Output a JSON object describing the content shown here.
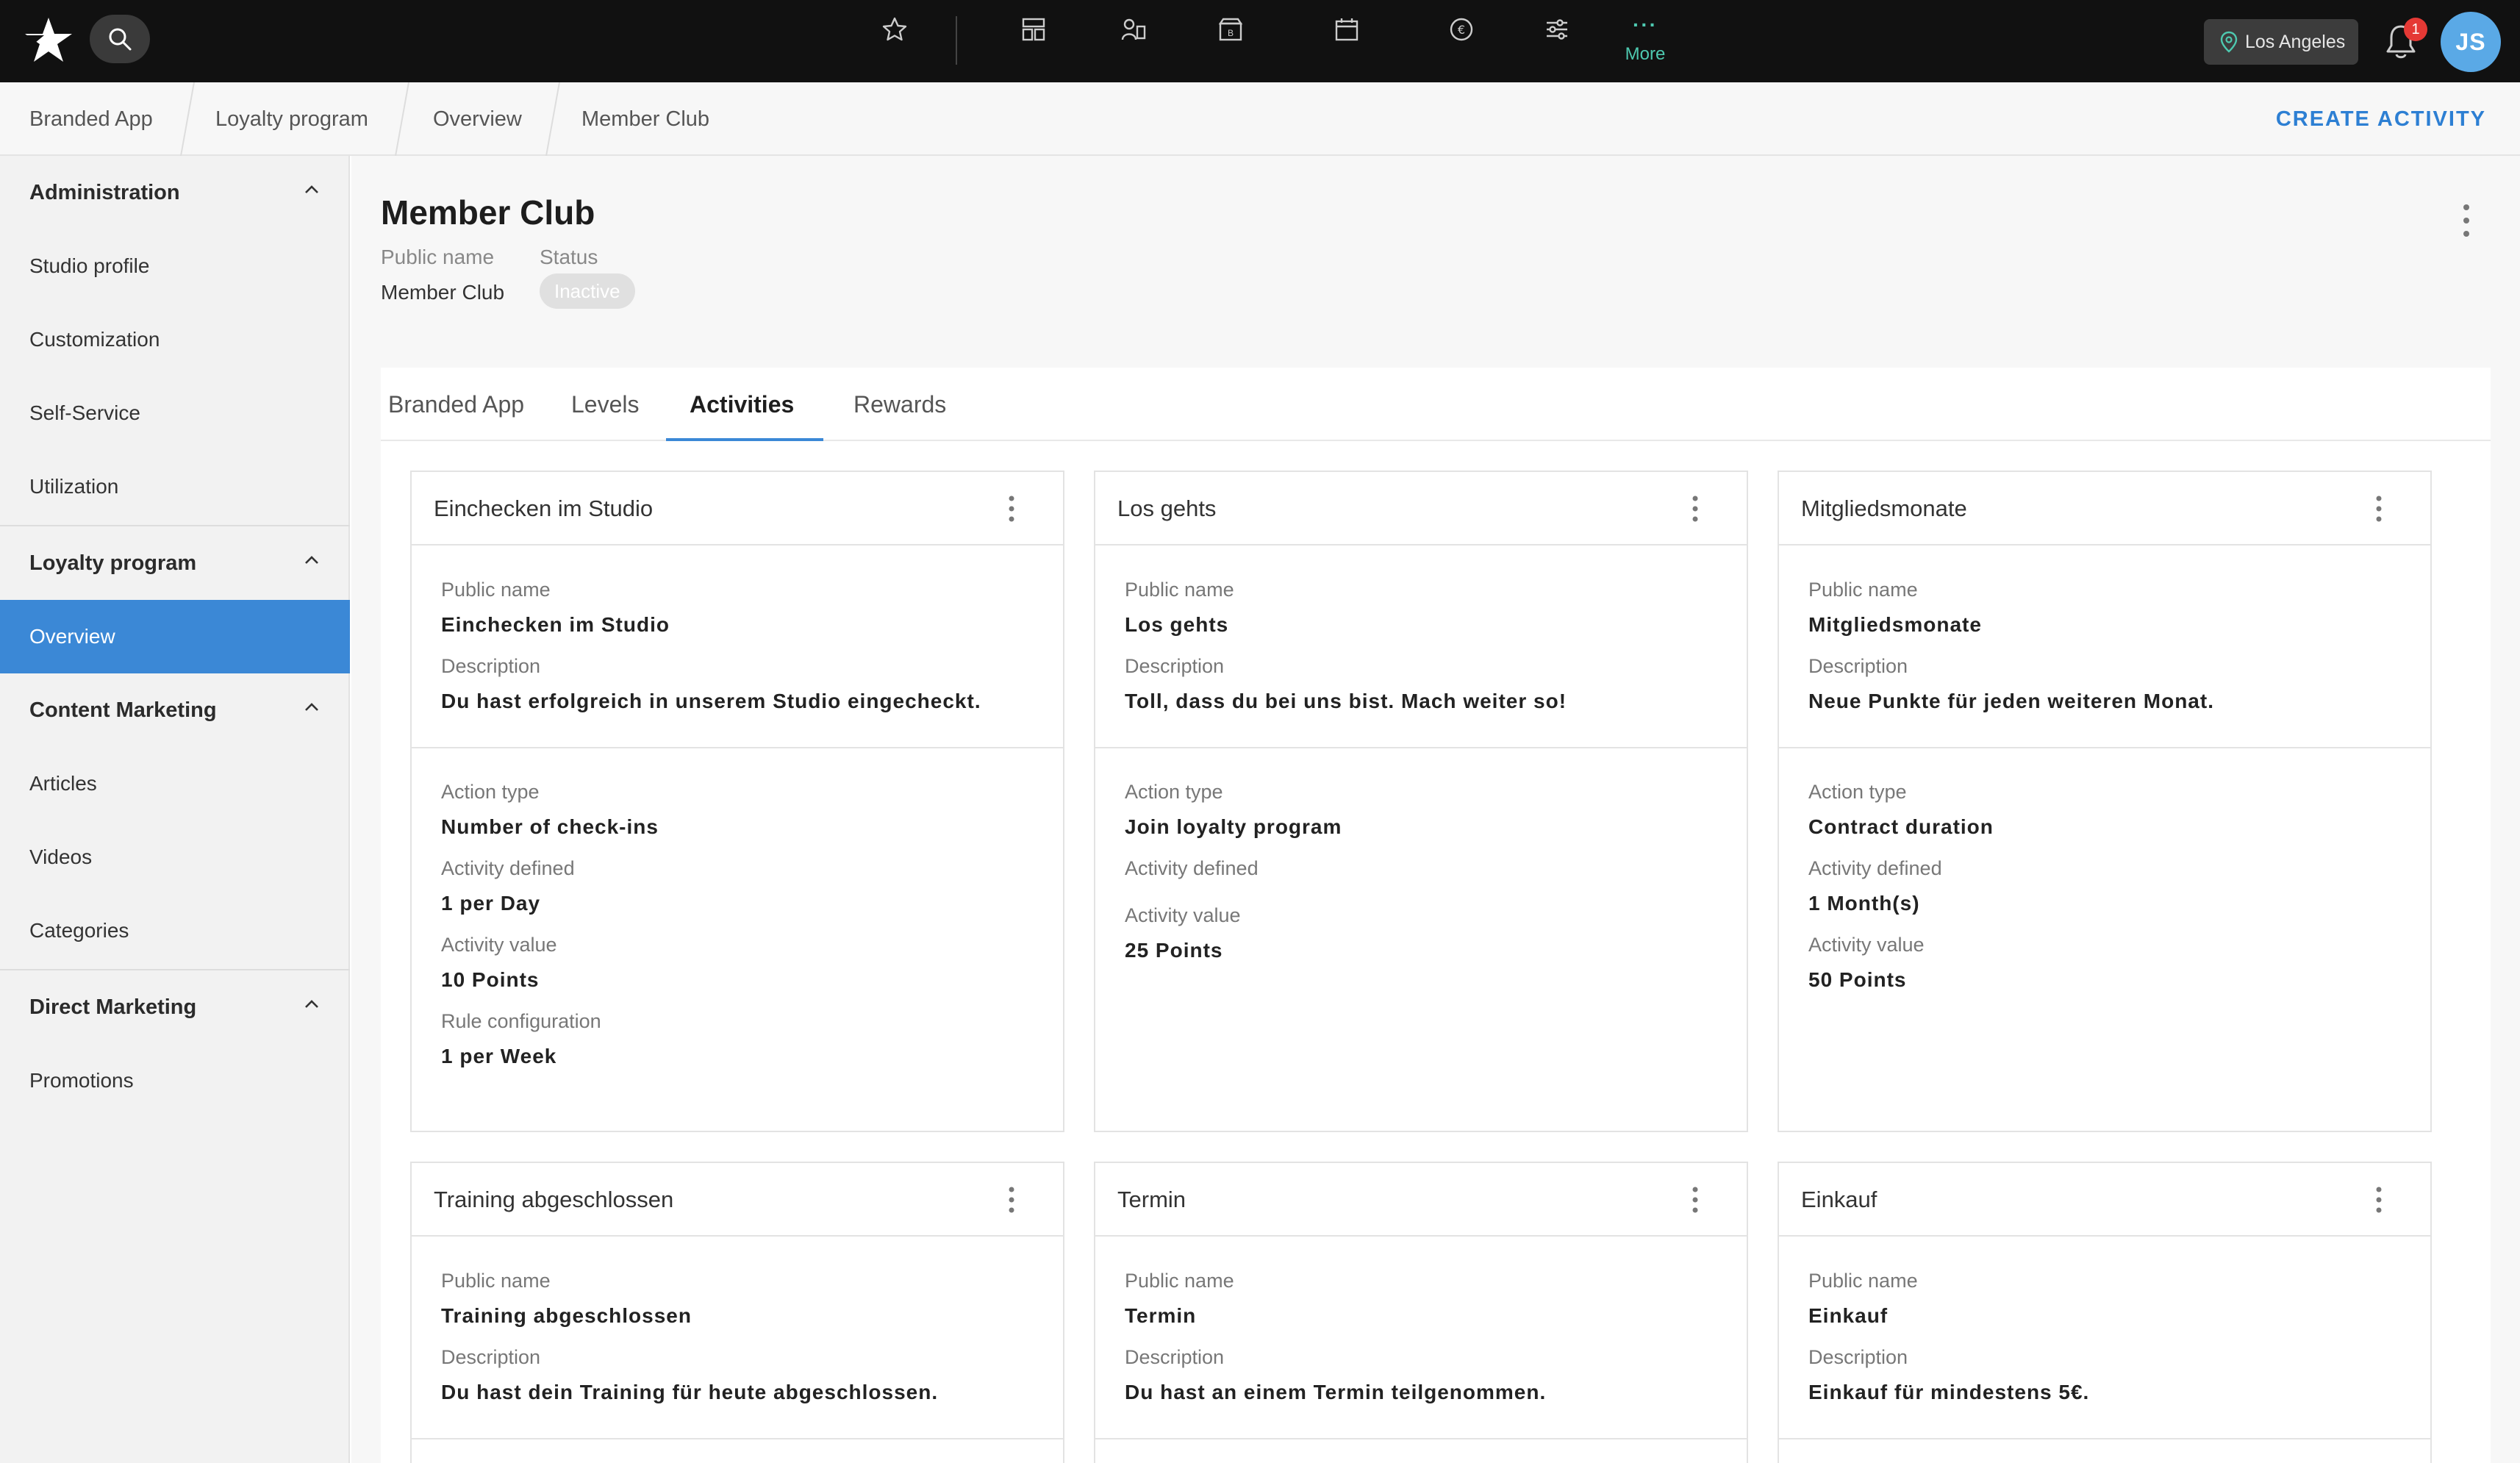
{
  "topbar": {
    "more_label": "More",
    "more_dots": "···",
    "location": "Los Angeles",
    "notification_count": "1",
    "avatar_initials": "JS"
  },
  "breadcrumb": [
    "Branded App",
    "Loyalty program",
    "Overview",
    "Member Club"
  ],
  "create_activity_label": "CREATE ACTIVITY",
  "sidebar": {
    "groups": [
      {
        "label": "Administration",
        "items": [
          "Studio profile",
          "Customization",
          "Self-Service",
          "Utilization"
        ]
      },
      {
        "label": "Loyalty program",
        "items": [
          "Overview"
        ]
      },
      {
        "label": "Content Marketing",
        "items": [
          "Articles",
          "Videos",
          "Categories"
        ]
      },
      {
        "label": "Direct Marketing",
        "items": [
          "Promotions"
        ]
      }
    ],
    "active_item": "Overview"
  },
  "page": {
    "title": "Member Club",
    "public_name_label": "Public name",
    "public_name_value": "Member Club",
    "status_label": "Status",
    "status_value": "Inactive"
  },
  "tabs": [
    "Branded App",
    "Levels",
    "Activities",
    "Rewards"
  ],
  "active_tab": "Activities",
  "labels": {
    "public_name": "Public name",
    "description": "Description",
    "action_type": "Action type",
    "activity_defined": "Activity defined",
    "activity_value": "Activity value",
    "rule_configuration": "Rule configuration"
  },
  "cards": [
    {
      "title": "Einchecken im Studio",
      "public_name": "Einchecken im Studio",
      "description": "Du hast erfolgreich in unserem Studio eingecheckt.",
      "action_type": "Number of check-ins",
      "activity_defined": "1 per Day",
      "activity_value": "10 Points",
      "rule_configuration": "1 per Week"
    },
    {
      "title": "Los gehts",
      "public_name": "Los gehts",
      "description": "Toll, dass du bei uns bist. Mach weiter so!",
      "action_type": "Join loyalty program",
      "activity_defined": "",
      "activity_value": "25 Points"
    },
    {
      "title": "Mitgliedsmonate",
      "public_name": "Mitgliedsmonate",
      "description": "Neue Punkte für jeden weiteren Monat.",
      "action_type": "Contract duration",
      "activity_defined": "1 Month(s)",
      "activity_value": "50 Points"
    },
    {
      "title": "Training abgeschlossen",
      "public_name": "Training abgeschlossen",
      "description": "Du hast dein Training für heute abgeschlossen."
    },
    {
      "title": "Termin",
      "public_name": "Termin",
      "description": "Du hast an einem Termin teilgenommen."
    },
    {
      "title": "Einkauf",
      "public_name": "Einkauf",
      "description": "Einkauf für mindestens 5€."
    }
  ]
}
